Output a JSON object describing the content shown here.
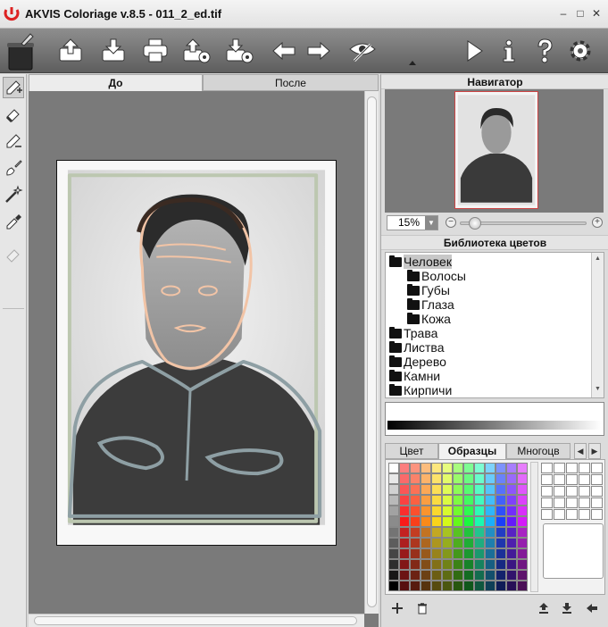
{
  "window": {
    "title": "AKVIS Coloriage v.8.5 - 011_2_ed.tif",
    "controls": [
      "minimize-icon",
      "maximize-icon",
      "close-icon"
    ]
  },
  "toolbar": {
    "left_buttons": [
      "app-menu-icon",
      "open-image-icon",
      "save-image-icon",
      "print-icon",
      "export-settings-icon",
      "import-settings-icon",
      "undo-arrow-icon",
      "redo-arrow-icon",
      "preview-eye-icon"
    ],
    "right_buttons": [
      "run-icon",
      "info-icon",
      "help-icon",
      "settings-gear-icon"
    ]
  },
  "tools": [
    "pencil-plus-icon",
    "eraser-icon",
    "pencil-minus-icon",
    "brush-icon",
    "magic-wand-icon",
    "eyedropper-icon",
    "eraser-disabled-icon"
  ],
  "view_tabs": {
    "before": "До",
    "after": "После",
    "active": "before"
  },
  "navigator": {
    "title": "Навигатор",
    "zoom": "15%",
    "zoom_slider_fraction": 0.12
  },
  "color_library": {
    "title": "Библиотека цветов",
    "items": [
      {
        "label": "Человек",
        "level": 0,
        "open": true,
        "selected": true
      },
      {
        "label": "Волосы",
        "level": 1
      },
      {
        "label": "Губы",
        "level": 1
      },
      {
        "label": "Глаза",
        "level": 1
      },
      {
        "label": "Кожа",
        "level": 1
      },
      {
        "label": "Трава",
        "level": 0
      },
      {
        "label": "Листва",
        "level": 0
      },
      {
        "label": "Дерево",
        "level": 0
      },
      {
        "label": "Камни",
        "level": 0
      },
      {
        "label": "Кирпичи",
        "level": 0
      }
    ]
  },
  "swatch_tabs": {
    "color": "Цвет",
    "samples": "Образцы",
    "multicolor": "Многоцв",
    "active": "samples"
  },
  "bottom_buttons": [
    "add-icon",
    "trash-icon",
    "upload-icon",
    "download-icon",
    "back-arrow-icon"
  ],
  "colors": {
    "titlebar_bg": "#ececec",
    "toolbar_bg": "#6e6e6e",
    "canvas_bg": "#7a7a7a",
    "stroke_hair": "#3a2a22",
    "stroke_skin": "#f2c4a6",
    "stroke_clothes": "#8e9fa4",
    "stroke_background": "#bcc7b0"
  }
}
